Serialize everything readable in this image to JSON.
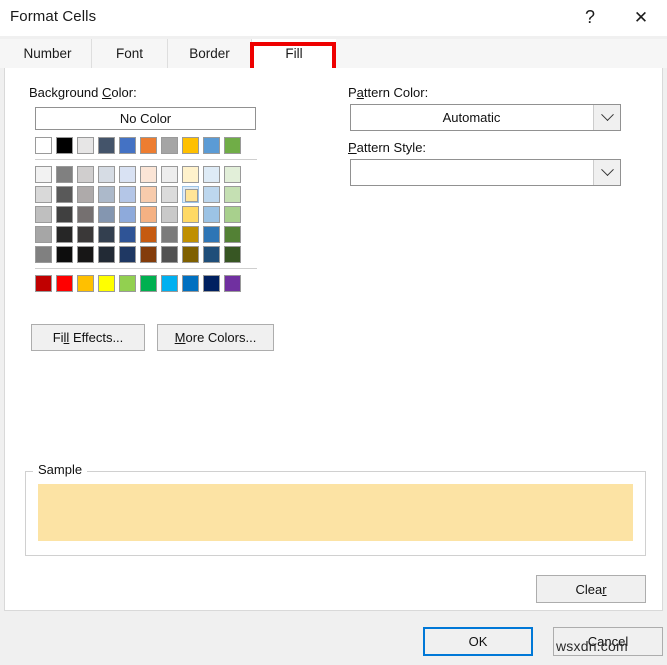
{
  "window": {
    "title": "Format Cells",
    "help_label": "?",
    "close_label": "✕"
  },
  "tabs": [
    {
      "label": "Number",
      "active": false
    },
    {
      "label": "Font",
      "active": false
    },
    {
      "label": "Border",
      "active": false
    },
    {
      "label": "Fill",
      "active": true
    }
  ],
  "annotation": {
    "target": "Fill",
    "color": "#ee0000"
  },
  "background_color": {
    "label_before": "Background ",
    "label_accel": "C",
    "label_after": "olor:",
    "no_color_label": "No Color",
    "theme_colors": [
      "#FFFFFF",
      "#000000",
      "#E7E6E6",
      "#44546A",
      "#4472C4",
      "#ED7D31",
      "#A5A5A5",
      "#FFC000",
      "#5B9BD5",
      "#70AD47"
    ],
    "tint_rows": [
      [
        "#F2F2F2",
        "#808080",
        "#D0CECE",
        "#D6DCE4",
        "#D9E2F3",
        "#FBE5D6",
        "#EDEDED",
        "#FFF2CC",
        "#DEEBF6",
        "#E2EFD9"
      ],
      [
        "#D9D9D9",
        "#595959",
        "#AEAAAA",
        "#ACB9CA",
        "#B4C6E7",
        "#F7CBAC",
        "#DBDBDB",
        "#FFE598",
        "#BDD7EE",
        "#C5E0B3"
      ],
      [
        "#BFBFBF",
        "#404040",
        "#757070",
        "#8496B0",
        "#8EAADB",
        "#F4B183",
        "#C9C9C9",
        "#FFD965",
        "#9CC3E5",
        "#A8D08D"
      ],
      [
        "#A6A6A6",
        "#262626",
        "#3A3838",
        "#333F4F",
        "#2F5496",
        "#C55A11",
        "#7B7B7B",
        "#BF8F00",
        "#2E75B5",
        "#538135"
      ],
      [
        "#808080",
        "#0D0D0D",
        "#171616",
        "#222A35",
        "#1F3863",
        "#833C0B",
        "#525252",
        "#7F6000",
        "#1F4E79",
        "#375623"
      ]
    ],
    "standard_colors": [
      "#C00000",
      "#FF0000",
      "#FFC000",
      "#FFFF00",
      "#92D050",
      "#00B050",
      "#00B0F0",
      "#0070C0",
      "#002060",
      "#7030A0"
    ],
    "selected_swatch": {
      "row": 1,
      "col": 7,
      "color": "#FFE598"
    }
  },
  "buttons": {
    "fill_effects_before": "Fi",
    "fill_effects_accel": "ll",
    "fill_effects_after": " Effects...",
    "more_colors_accel": "M",
    "more_colors_after": "ore Colors...",
    "clear_before": "Clea",
    "clear_accel": "r",
    "clear_after": ""
  },
  "pattern_color": {
    "label_accel": "P",
    "label_mid": "a",
    "label_after": "ttern Color:",
    "value": "Automatic"
  },
  "pattern_style": {
    "label_accel": "P",
    "label_after": "attern Style:",
    "value": ""
  },
  "sample": {
    "legend": "Sample",
    "fill_color": "#FCE3A4"
  },
  "footer": {
    "ok_label": "OK",
    "cancel_label": "Cancel"
  },
  "watermark": {
    "text": "wsxdn.com"
  }
}
